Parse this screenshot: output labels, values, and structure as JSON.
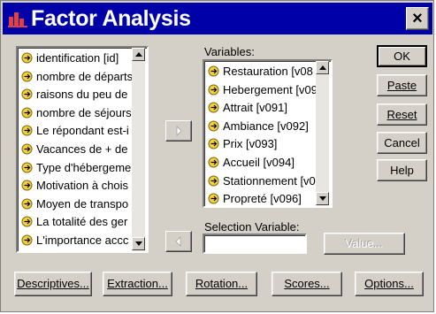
{
  "window": {
    "title": "Factor Analysis",
    "close_glyph": "×"
  },
  "source_list": {
    "items": [
      "identification [id]",
      "nombre de départs",
      "raisons du peu de",
      "nombre de séjours",
      "Le répondant est-i",
      "Vacances de + de",
      "Type d'hébergeme",
      "Motivation à chois",
      "Moyen de transpo",
      "La totalité des ger",
      "L'importance accc"
    ]
  },
  "variables": {
    "label": "Variables:",
    "items": [
      "Restauration [v08",
      "Hebergement [v09",
      "Attrait [v091]",
      "Ambiance [v092]",
      "Prix [v093]",
      "Accueil [v094]",
      "Stationnement [v0",
      "Propreté [v096]"
    ]
  },
  "selection_variable": {
    "label": "Selection Variable:",
    "value": ""
  },
  "buttons": {
    "ok": "OK",
    "paste": "Paste",
    "reset": "Reset",
    "cancel": "Cancel",
    "help": "Help",
    "value": "Value...",
    "descriptives": "Descriptives...",
    "extraction": "Extraction...",
    "rotation": "Rotation...",
    "scores": "Scores...",
    "options": "Options..."
  },
  "icons": {
    "title": "factor-analysis-icon",
    "variable": "scale-variable-icon",
    "move_right": "arrow-right-icon",
    "move_left": "arrow-left-icon"
  }
}
